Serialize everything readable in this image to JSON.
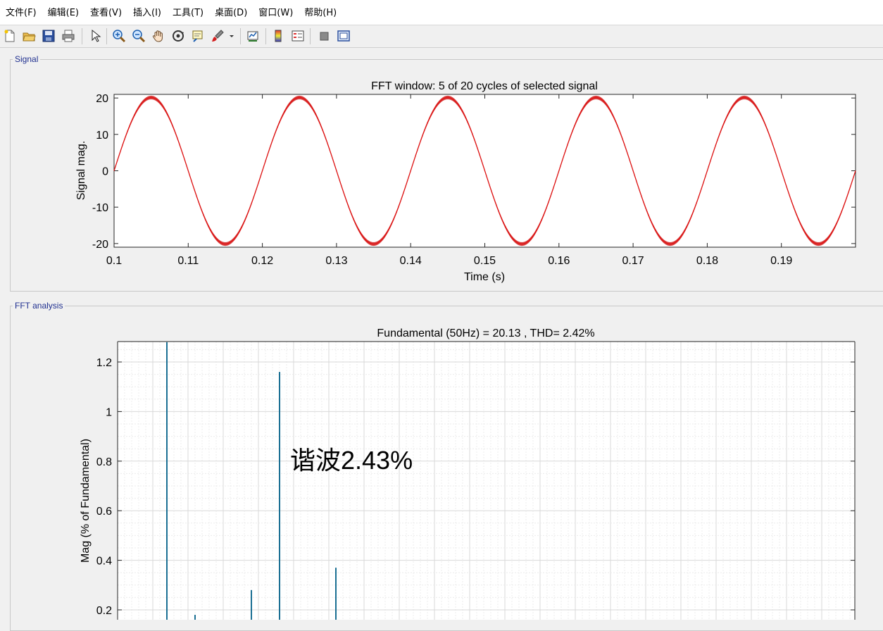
{
  "menu": [
    "文件(F)",
    "编辑(E)",
    "查看(V)",
    "插入(I)",
    "工具(T)",
    "桌面(D)",
    "窗口(W)",
    "帮助(H)"
  ],
  "toolbar": {
    "buttons": [
      "new-file-icon",
      "open-folder-icon",
      "save-icon",
      "print-icon",
      "pointer-icon",
      "zoom-in-icon",
      "zoom-out-icon",
      "pan-hand-icon",
      "rotate-3d-icon",
      "data-cursor-icon",
      "brush-icon",
      "link-plot-icon",
      "colorbar-icon",
      "legend-icon",
      "hide-plot-tools-icon",
      "show-plot-tools-icon"
    ]
  },
  "panels": {
    "signal": {
      "title": "Signal"
    },
    "fft": {
      "title": "FFT analysis"
    }
  },
  "annotation": {
    "text": "谐波2.43%"
  },
  "colors": {
    "signal_line": "#dd1111",
    "fft_bars": "#1a6f93",
    "panel_title": "#1f2f8f"
  },
  "chart_data": [
    {
      "type": "line",
      "title": "FFT window: 5 of 20 cycles of selected signal",
      "xlabel": "Time (s)",
      "ylabel": "Signal mag.",
      "xlim": [
        0.1,
        0.2
      ],
      "ylim": [
        -21,
        21
      ],
      "xticks": [
        0.1,
        0.11,
        0.12,
        0.13,
        0.14,
        0.15,
        0.16,
        0.17,
        0.18,
        0.19
      ],
      "xtick_labels": [
        "0.1",
        "0.11",
        "0.12",
        "0.13",
        "0.14",
        "0.15",
        "0.16",
        "0.17",
        "0.18",
        "0.19"
      ],
      "yticks": [
        20,
        10,
        0,
        -10,
        -20
      ],
      "ytick_labels": [
        "20",
        "10",
        "0",
        "-10",
        "-20"
      ],
      "grid": false,
      "series": [
        {
          "amplitude": 20.13,
          "frequency_hz": 50,
          "ripple": 0.5
        }
      ]
    },
    {
      "type": "bar",
      "title": "Fundamental (50Hz) = 20.13 , THD= 2.42%",
      "xlabel": "",
      "ylabel": "Mag (% of Fundamental)",
      "ylim_top": 1.28,
      "yticks": [
        1.2,
        1,
        0.8,
        0.6,
        0.4,
        0.2
      ],
      "ytick_labels": [
        "1.2",
        "1",
        "0.8",
        "0.6",
        "0.4",
        "0.2"
      ],
      "grid": true,
      "bars": [
        {
          "harmonic": 3.5,
          "value": 1.28
        },
        {
          "harmonic": 4.5,
          "value": 0.18
        },
        {
          "harmonic": 6.5,
          "value": 0.28
        },
        {
          "harmonic": 7.5,
          "value": 1.16
        },
        {
          "harmonic": 9.5,
          "value": 0.37
        }
      ]
    }
  ]
}
